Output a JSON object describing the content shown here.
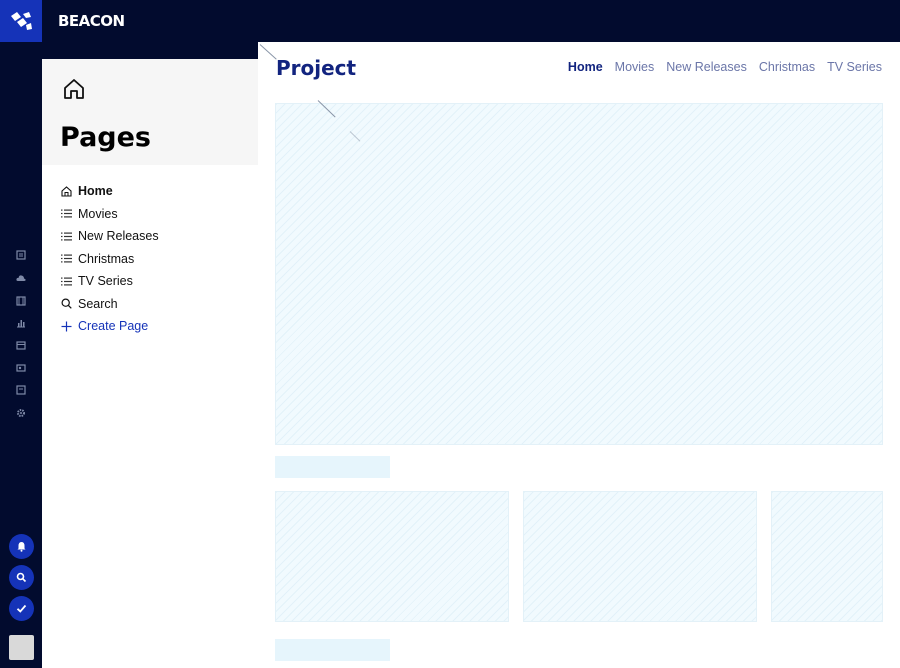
{
  "app": {
    "brand": "BEACON"
  },
  "sidebar_panel": {
    "title": "Pages",
    "items": [
      {
        "label": "Home",
        "icon": "home-icon",
        "active": true
      },
      {
        "label": "Movies",
        "icon": "list-icon"
      },
      {
        "label": "New Releases",
        "icon": "list-icon"
      },
      {
        "label": "Christmas",
        "icon": "list-icon"
      },
      {
        "label": "TV Series",
        "icon": "list-icon"
      },
      {
        "label": "Search",
        "icon": "search-icon"
      },
      {
        "label": "Create Page",
        "icon": "plus-icon"
      }
    ]
  },
  "preview": {
    "title": "Project",
    "nav": [
      "Home",
      "Movies",
      "New Releases",
      "Christmas",
      "TV Series"
    ],
    "active_nav": "Home"
  },
  "rail": {
    "icons": [
      "posts-icon",
      "cloud-icon",
      "film-icon",
      "chart-icon",
      "calendar-icon",
      "media-icon",
      "notes-icon",
      "gear-icon"
    ],
    "buttons": [
      "bell-icon",
      "search-icon",
      "check-icon"
    ]
  },
  "colors": {
    "navy": "#020b2e",
    "accent": "#1533b8",
    "title": "#12247f",
    "placeholder": "#f1fafe"
  }
}
